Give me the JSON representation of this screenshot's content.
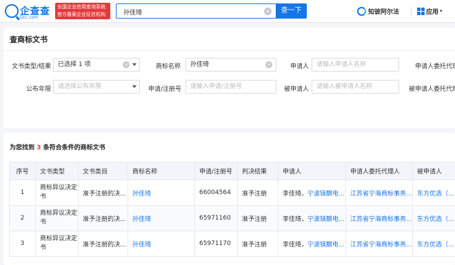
{
  "header": {
    "logo_text": "企查查",
    "logo_sub": "Qcc.com",
    "slogan_line1": "全国企业信用查询系统",
    "slogan_line2": "官方备案企业征信机构",
    "search_value": "孙佳琦",
    "search_button": "查一下",
    "knowfa_label": "知彼阿尔法",
    "apps_label": "应用"
  },
  "panel": {
    "title": "查商标文书",
    "fields": {
      "doc_type_label": "文书类型/结果",
      "doc_type_value": "已选择 1 项",
      "trademark_name_label": "商标名称",
      "trademark_name_value": "孙佳琦",
      "applicant_label": "申请人",
      "applicant_placeholder": "请输入申请人名称",
      "agent_label": "申请人委托代理人",
      "year_label": "公布年限",
      "year_placeholder": "请选择公布年限",
      "regno_label": "申请/注册号",
      "regno_placeholder": "请输入申请/注册号",
      "respondent_label": "被申请人",
      "respondent_placeholder": "请输入被申请人名称",
      "respondent_agent_label": "被申请人委托代理"
    }
  },
  "results": {
    "prefix": "为您找到",
    "count": "3",
    "suffix": "条符合条件的商标文书",
    "columns": [
      "序号",
      "文书类型",
      "文书类目",
      "商标名称",
      "申请/注册号",
      "判决结果",
      "申请人",
      "申请人委托代理人",
      "被申请人"
    ],
    "rows": [
      {
        "no": "1",
        "doc_type": "商标异议决定书",
        "category": "准予注册的决...",
        "name": "孙佳琦",
        "regno": "66004564",
        "result": "准予注册",
        "applicant_a": "李佳琦，",
        "applicant_b": "宁波镁麒电...",
        "agent": "江苏省宁海商标事务...",
        "respondent": "东方优选（..."
      },
      {
        "no": "2",
        "doc_type": "商标异议决定书",
        "category": "准予注册的决...",
        "name": "孙佳琦",
        "regno": "65971160",
        "result": "准予注册",
        "applicant_a": "李佳琦，",
        "applicant_b": "宁波镁麒电...",
        "agent": "江苏省宁海商标事务...",
        "respondent": "东方优选（..."
      },
      {
        "no": "3",
        "doc_type": "商标异议决定书",
        "category": "准予注册的决...",
        "name": "孙佳琦",
        "regno": "65971170",
        "result": "准予注册",
        "applicant_a": "李佳琦，",
        "applicant_b": "宁波镁麒电...",
        "agent": "江苏省宁海商标事务...",
        "respondent": "东方优选（..."
      }
    ]
  }
}
